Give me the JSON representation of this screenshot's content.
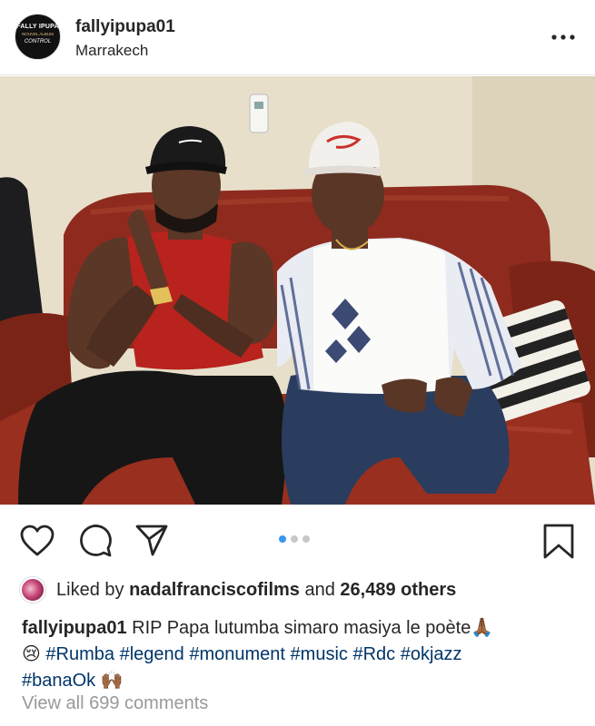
{
  "post": {
    "username": "fallyipupa01",
    "location": "Marrakech",
    "avatar_text": {
      "top": "FALLY IPUPA",
      "middle": "NOUVEL ALBUM",
      "bottom": "CONTROL"
    },
    "liked_prefix": "Liked by",
    "liked_by": "nadalfranciscofilms",
    "liked_and": "and",
    "liked_others": "26,489 others",
    "caption": {
      "username": "fallyipupa01",
      "text": "RIP Papa lutumba simaro masiya le poète",
      "emoji_1": "🙏🏾",
      "emoji_2": "😢",
      "hashtags": [
        "#Rumba",
        "#legend",
        "#monument",
        "#music",
        "#Rdc",
        "#okjazz",
        "#banaOk"
      ],
      "emoji_3": "🙌🏾"
    },
    "view_comments": "View all 699 comments",
    "carousel": {
      "count": 3,
      "active_index": 0
    }
  },
  "icons": {
    "more": "more-options-icon",
    "like": "heart-icon",
    "comment": "comment-icon",
    "share": "share-icon",
    "save": "bookmark-icon"
  },
  "colors": {
    "text": "#262626",
    "hashtag": "#003569",
    "muted": "#999999",
    "carousel_active": "#3897f0",
    "carousel_inactive": "#c7c7c7"
  }
}
